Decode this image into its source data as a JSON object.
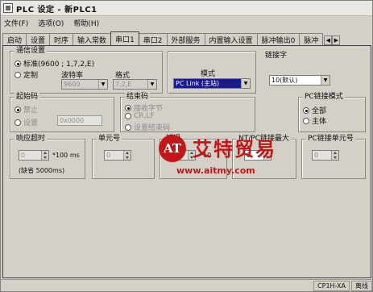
{
  "window": {
    "title": "PLC 设定 - 新PLC1"
  },
  "menu": [
    "文件(F)",
    "选项(O)",
    "帮助(H)"
  ],
  "tabs": [
    "启动",
    "设置",
    "时序",
    "输入常数",
    "串口1",
    "串口2",
    "外部服务",
    "内置输入设置",
    "脉冲输出0",
    "脉冲"
  ],
  "active_tab": "串口1",
  "comm": {
    "group_label": "通信设置",
    "standard_label": "标准(9600 ; 1,7,2,E)",
    "custom_label": "定制",
    "baud_label": "波特率",
    "baud_value": "9600",
    "format_label": "格式",
    "format_value": "7,2,E",
    "selected": "标准"
  },
  "mode": {
    "label": "模式",
    "value": "PC Link (主站)"
  },
  "link_word": {
    "label": "链接字",
    "value": "10(默认)"
  },
  "start_code": {
    "group_label": "起始码",
    "disabled_label": "禁止",
    "set_label": "设置",
    "hex_value": "0x0000"
  },
  "end_code": {
    "group_label": "结束码",
    "option1": "接收字节",
    "option2": "CR,LF",
    "option3": "设置结束码"
  },
  "pc_link_mode": {
    "group_label": "PC链接模式",
    "all_label": "全部",
    "master_label": "主体",
    "selected": "全部"
  },
  "response_timeout": {
    "label": "响应超时",
    "value": "0",
    "unit": "*100 ms",
    "default_text": "(缺省 5000ms)"
  },
  "unit_no": {
    "label": "单元号",
    "value": "0"
  },
  "delay": {
    "label": "延迟",
    "value": "0",
    "unit": "*10"
  },
  "nt_pc_max": {
    "label": "NT/PC链接最大",
    "value": "0"
  },
  "pc_link_unit": {
    "label": "PC链接单元号",
    "value": "0"
  },
  "watermark": {
    "logo_text": "AT",
    "name": "艾特贸易",
    "url": "www.aitmy.com"
  },
  "status": {
    "model": "CP1H-XA",
    "state": "离线"
  }
}
